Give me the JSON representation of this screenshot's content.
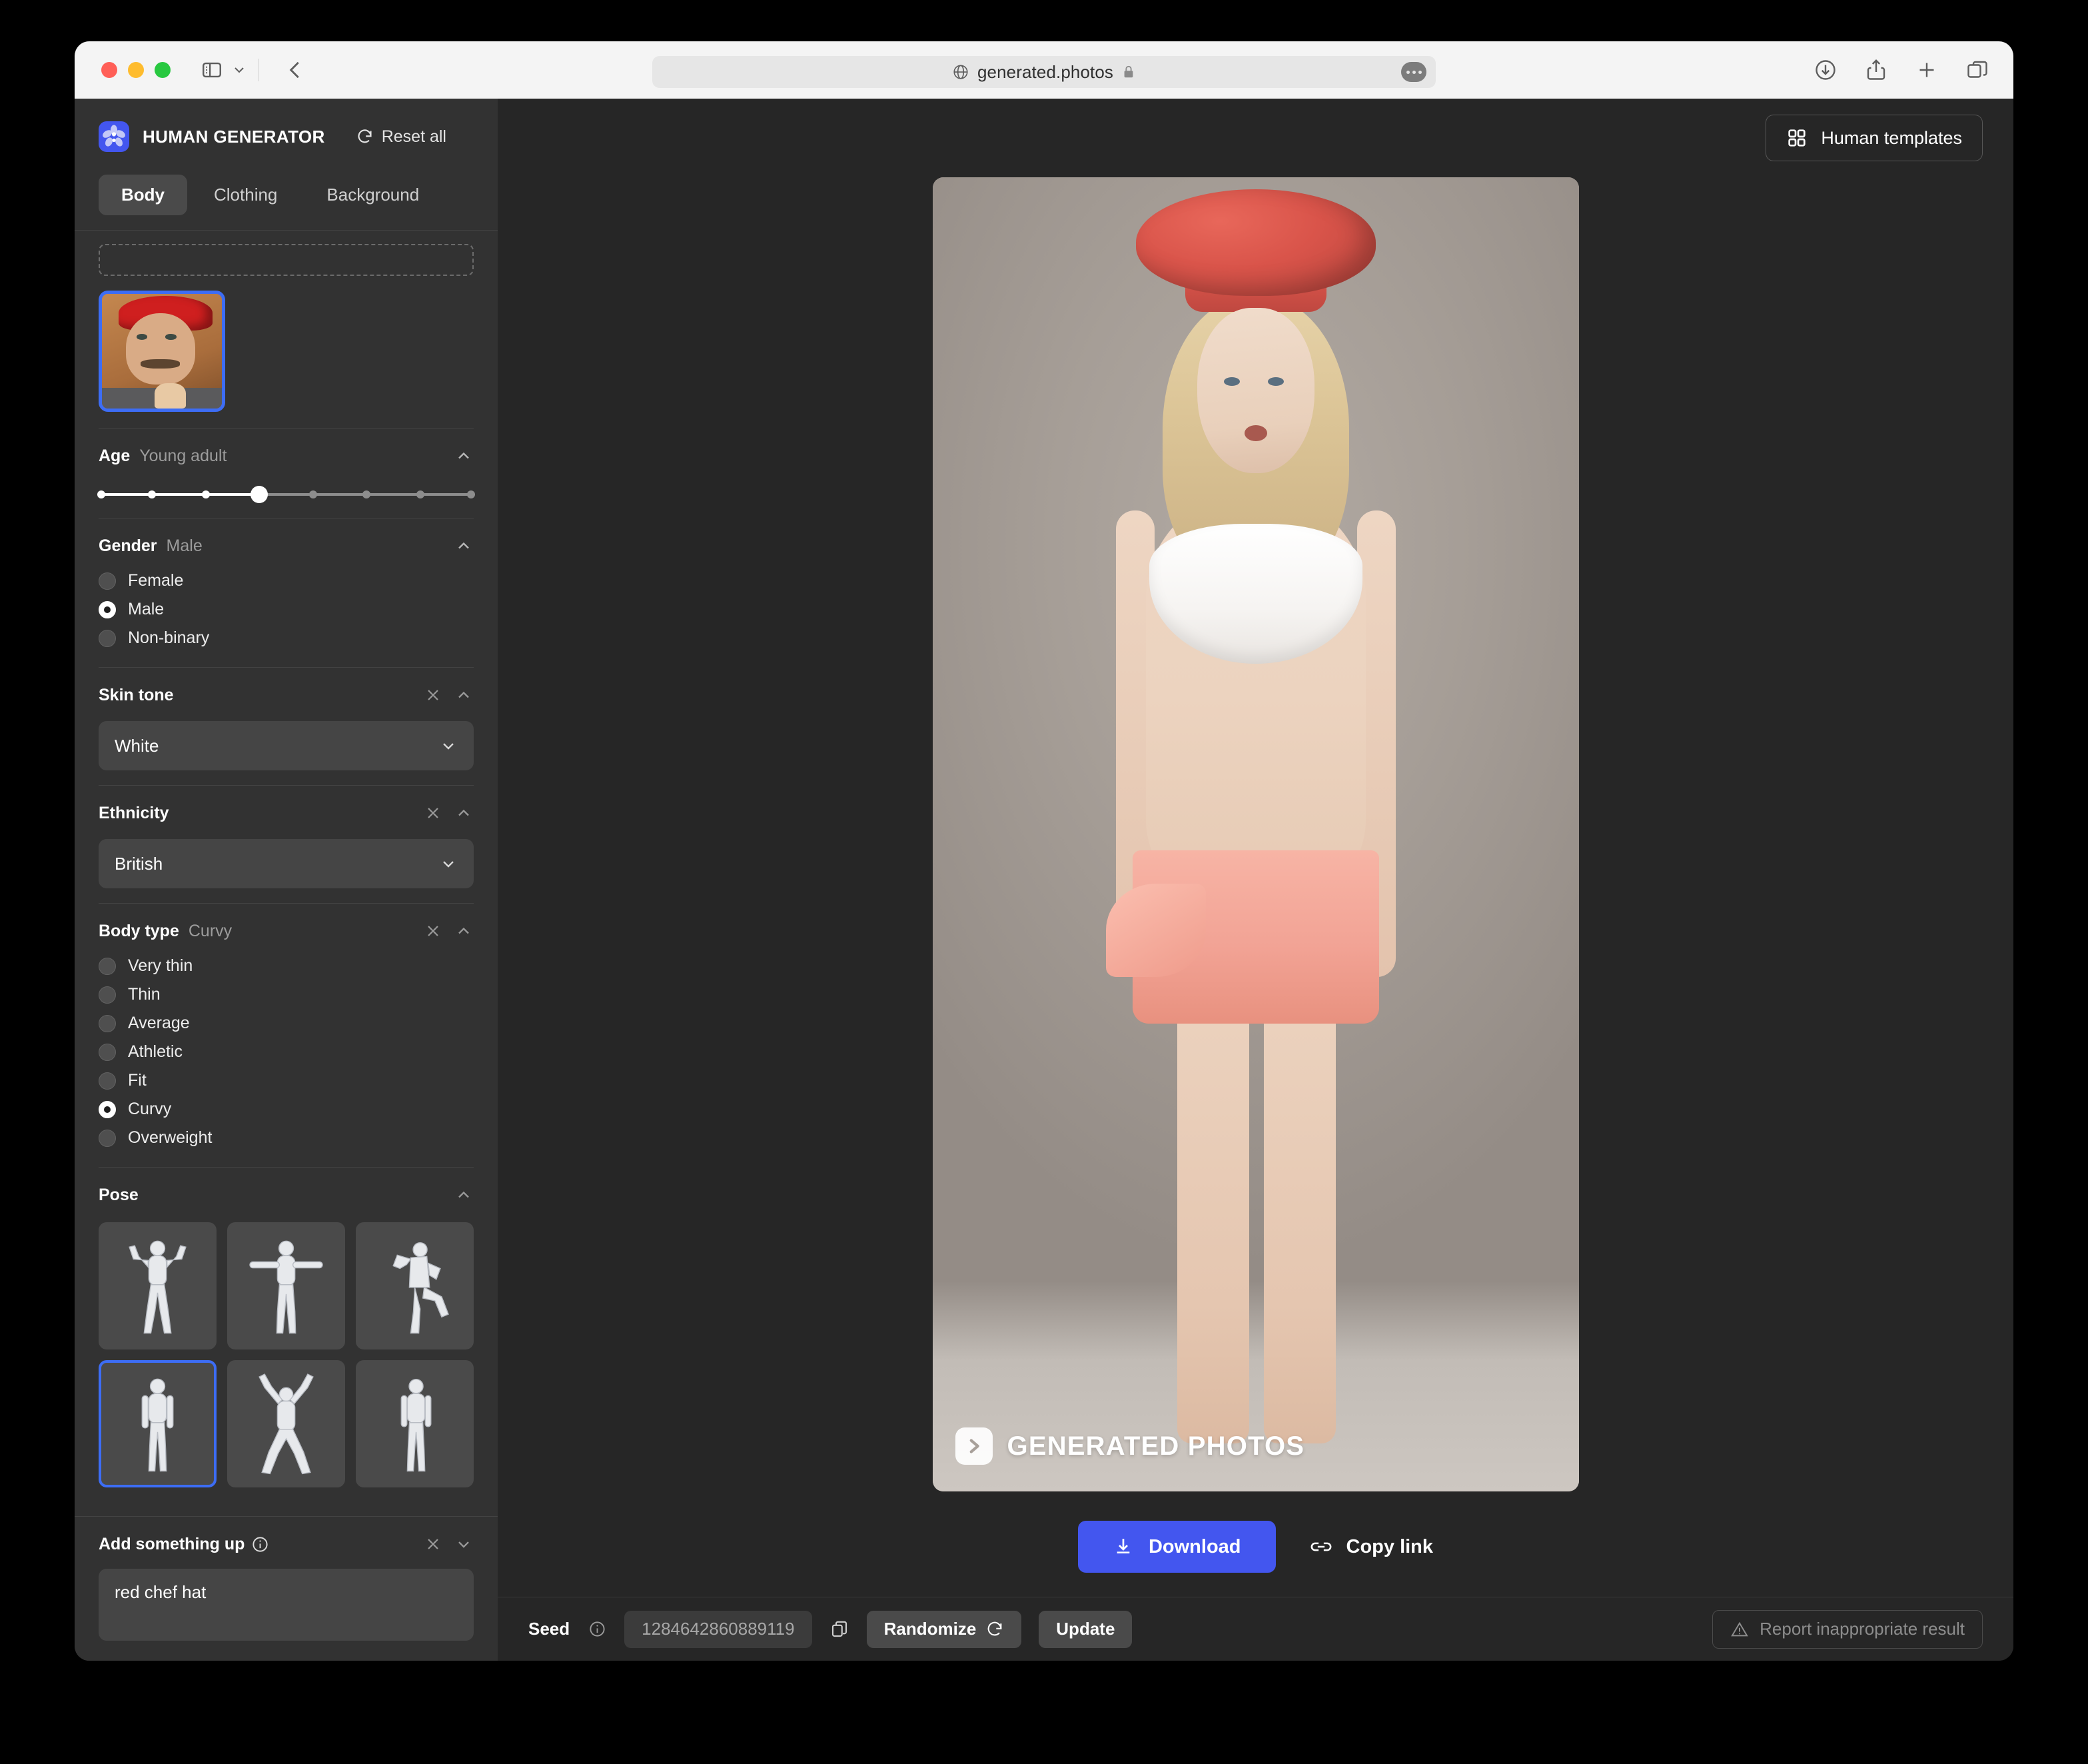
{
  "browser": {
    "url": "generated.photos",
    "icons": {
      "sidebar": "sidebar-toggle-icon",
      "chevron": "chevron-down-icon",
      "back": "back-arrow-icon",
      "globe": "globe-icon",
      "lock": "lock-icon",
      "more": "more-options-icon",
      "downloads": "downloads-icon",
      "share": "share-icon",
      "newtab": "new-tab-icon",
      "tabs": "tab-overview-icon"
    }
  },
  "sidebar": {
    "brand": "HUMAN GENERATOR",
    "reset_label": "Reset all",
    "tabs": [
      {
        "label": "Body",
        "active": true
      },
      {
        "label": "Clothing",
        "active": false
      },
      {
        "label": "Background",
        "active": false
      }
    ],
    "face_reference": {
      "name": "uploaded-face-thumbnail",
      "selected": true
    },
    "sections": {
      "age": {
        "title": "Age",
        "value": "Young adult",
        "ticks": 8,
        "selected_index": 3
      },
      "gender": {
        "title": "Gender",
        "value": "Male",
        "options": [
          "Female",
          "Male",
          "Non-binary"
        ],
        "selected": "Male"
      },
      "skin_tone": {
        "title": "Skin tone",
        "value": "White"
      },
      "ethnicity": {
        "title": "Ethnicity",
        "value": "British"
      },
      "body_type": {
        "title": "Body type",
        "value": "Curvy",
        "options": [
          "Very thin",
          "Thin",
          "Average",
          "Athletic",
          "Fit",
          "Curvy",
          "Overweight"
        ],
        "selected": "Curvy"
      },
      "pose": {
        "title": "Pose",
        "cells": [
          {
            "id": "pose-flex",
            "selected": false
          },
          {
            "id": "pose-t-stance",
            "selected": false
          },
          {
            "id": "pose-leg-raise",
            "selected": false
          },
          {
            "id": "pose-standing",
            "selected": true
          },
          {
            "id": "pose-arms-up",
            "selected": false
          },
          {
            "id": "pose-relaxed",
            "selected": false
          }
        ]
      },
      "prompt": {
        "title": "Add something up",
        "value": "red chef hat"
      }
    }
  },
  "main": {
    "templates_button": "Human templates",
    "watermark": "GENERATED PHOTOS",
    "download_label": "Download",
    "copy_link_label": "Copy link",
    "seed_label": "Seed",
    "seed_value": "1284642860889119",
    "randomize_label": "Randomize",
    "update_label": "Update",
    "report_label": "Report inappropriate result"
  },
  "colors": {
    "accent_blue": "#4356ef",
    "selection_blue": "#3d6df5",
    "sidebar_bg": "#323232",
    "main_bg": "#262626",
    "hat_red": "#d9544a",
    "skirt_pink": "#f2a395"
  }
}
